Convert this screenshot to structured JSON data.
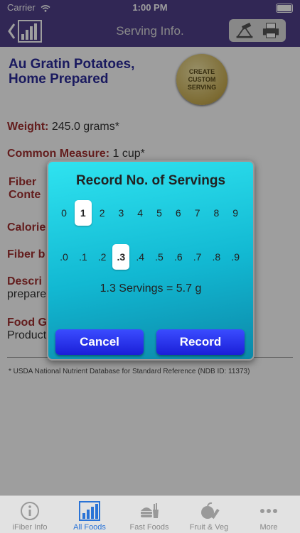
{
  "status": {
    "carrier": "Carrier",
    "time": "1:00 PM"
  },
  "nav": {
    "title": "Serving Info."
  },
  "food": {
    "name_line1": "Au Gratin Potatoes,",
    "name_line2": "Home Prepared",
    "seal_line1": "CREATE",
    "seal_line2": "CUSTOM",
    "seal_line3": "SERVING"
  },
  "fields": {
    "weight_label": "Weight:",
    "weight_value": "245.0 grams*",
    "measure_label": "Common Measure:",
    "measure_value": "1 cup*",
    "fiber_content_label_1": "Fiber",
    "fiber_content_label_2": "Conte",
    "calories_label": "Calorie",
    "fiber_by_label": "Fiber b",
    "descr_label": "Descri",
    "descr_value": "prepare",
    "foodgroup_label": "Food G",
    "foodgroup_value": "Product"
  },
  "footnote": "* USDA National Nutrient Database for Standard Reference (NDB ID: 11373)",
  "dialog": {
    "title": "Record No. of Servings",
    "whole_options": [
      "0",
      "1",
      "2",
      "3",
      "4",
      "5",
      "6",
      "7",
      "8",
      "9"
    ],
    "whole_selected": "1",
    "fraction_options": [
      ".0",
      ".1",
      ".2",
      ".3",
      ".4",
      ".5",
      ".6",
      ".7",
      ".8",
      ".9"
    ],
    "fraction_selected": ".3",
    "result": "1.3 Servings = 5.7 g",
    "cancel_label": "Cancel",
    "record_label": "Record"
  },
  "tabs": [
    {
      "label": "iFiber Info",
      "icon": "info-icon",
      "active": false
    },
    {
      "label": "All Foods",
      "icon": "bar-chart-icon",
      "active": true
    },
    {
      "label": "Fast Foods",
      "icon": "burger-fries-icon",
      "active": false
    },
    {
      "label": "Fruit & Veg",
      "icon": "fruit-veg-icon",
      "active": false
    },
    {
      "label": "More",
      "icon": "more-dots-icon",
      "active": false
    }
  ]
}
